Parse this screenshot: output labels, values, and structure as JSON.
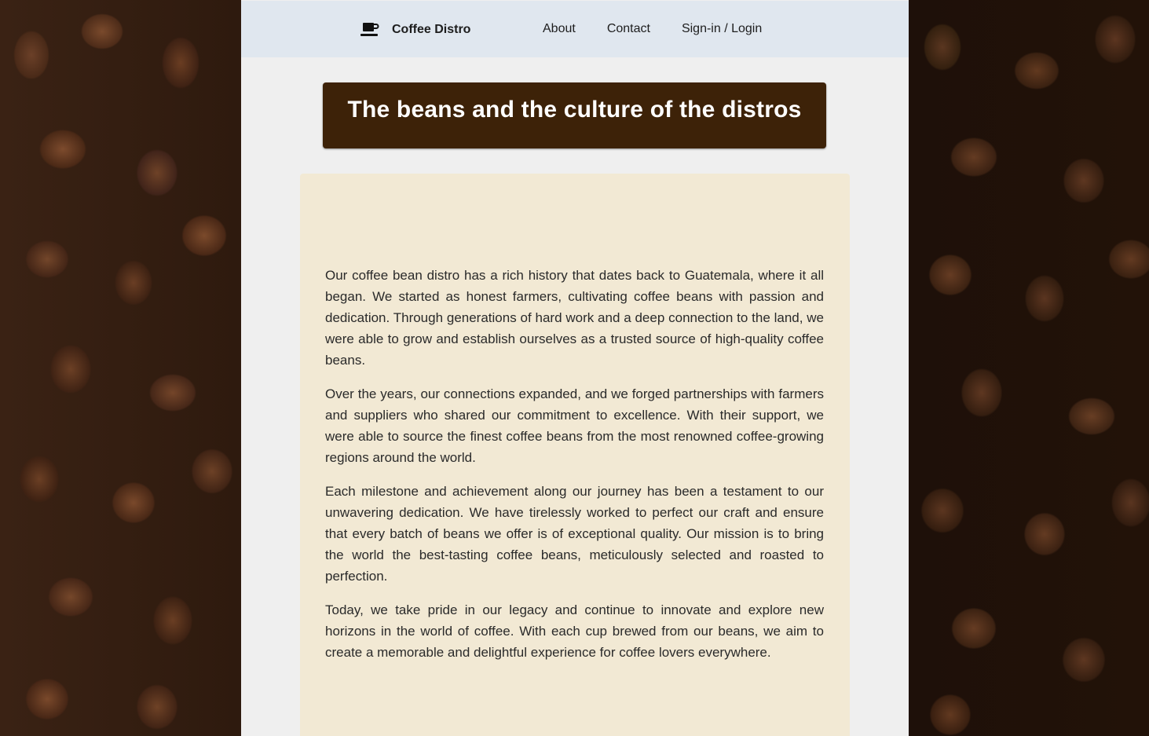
{
  "nav": {
    "brand_icon": "coffee-cup-icon",
    "brand_name": "Coffee Distro",
    "links": [
      "About",
      "Contact",
      "Sign-in / Login"
    ]
  },
  "hero": {
    "title": "The beans and the culture of the distros"
  },
  "content": {
    "paragraphs": [
      "Our coffee bean distro has a rich history that dates back to Guatemala, where it all began. We started as honest farmers, cultivating coffee beans with passion and dedication. Through generations of hard work and a deep connection to the land, we were able to grow and establish ourselves as a trusted source of high-quality coffee beans.",
      "Over the years, our connections expanded, and we forged partnerships with farmers and suppliers who shared our commitment to excellence. With their support, we were able to source the finest coffee beans from the most renowned coffee-growing regions around the world.",
      "Each milestone and achievement along our journey has been a testament to our unwavering dedication. We have tirelessly worked to perfect our craft and ensure that every batch of beans we offer is of exceptional quality. Our mission is to bring the world the best-tasting coffee beans, meticulously selected and roasted to perfection.",
      "Today, we take pride in our legacy and continue to innovate and explore new horizons in the world of coffee. With each cup brewed from our beans, we aim to create a memorable and delightful experience for coffee lovers everywhere."
    ]
  },
  "colors": {
    "navbar_bg": "#e0e7ef",
    "page_bg": "#efefef",
    "hero_bg": "#3d2208",
    "card_bg": "#f2e9d4"
  }
}
